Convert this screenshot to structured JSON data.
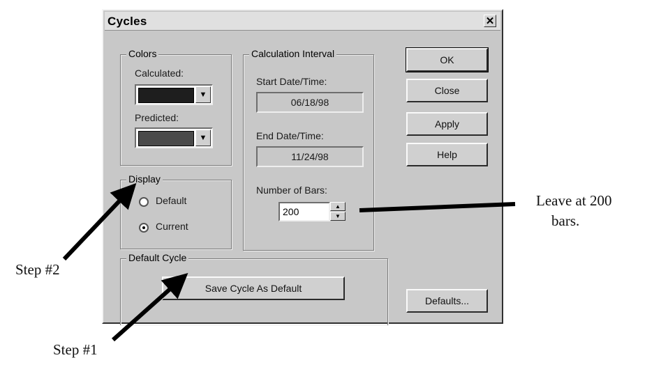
{
  "dialog": {
    "title": "Cycles",
    "close_glyph": "✕",
    "colors_group": {
      "legend": "Colors",
      "calculated_label": "Calculated:",
      "calculated_color": "#1e1e1e",
      "predicted_label": "Predicted:",
      "predicted_color": "#4a4a4a",
      "dropdown_glyph": "▼"
    },
    "display_group": {
      "legend": "Display",
      "options": [
        {
          "label": "Default",
          "selected": false
        },
        {
          "label": "Current",
          "selected": true
        }
      ]
    },
    "interval_group": {
      "legend": "Calculation Interval",
      "start_label": "Start Date/Time:",
      "start_value": "06/18/98",
      "end_label": "End Date/Time:",
      "end_value": "11/24/98",
      "bars_label": "Number of Bars:",
      "bars_value": "200",
      "spin_up_glyph": "▲",
      "spin_down_glyph": "▼"
    },
    "default_cycle_group": {
      "legend": "Default Cycle",
      "save_button": "Save Cycle As Default"
    },
    "buttons": {
      "ok": "OK",
      "close": "Close",
      "apply": "Apply",
      "help": "Help",
      "defaults": "Defaults..."
    }
  },
  "annotations": {
    "leave_line1": "Leave at 200",
    "leave_line2": "bars.",
    "step2": "Step #2",
    "step1": "Step #1"
  }
}
